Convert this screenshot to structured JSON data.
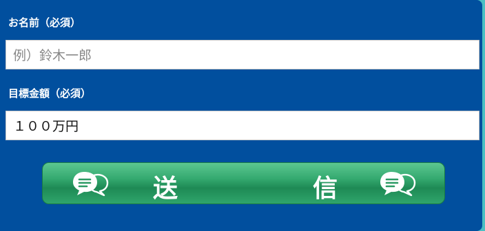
{
  "form": {
    "name_label": "お名前（必須）",
    "name_placeholder": "例）鈴木一郎",
    "amount_label": "目標金額（必須）",
    "amount_value": "１００万円",
    "submit_char_1": "送",
    "submit_char_2": "信",
    "submit_icon": "chat-bubbles-icon"
  },
  "colors": {
    "panel_bg": "#014f9e",
    "page_bg": "#4bbfc3",
    "button_green": "#35aa70"
  }
}
